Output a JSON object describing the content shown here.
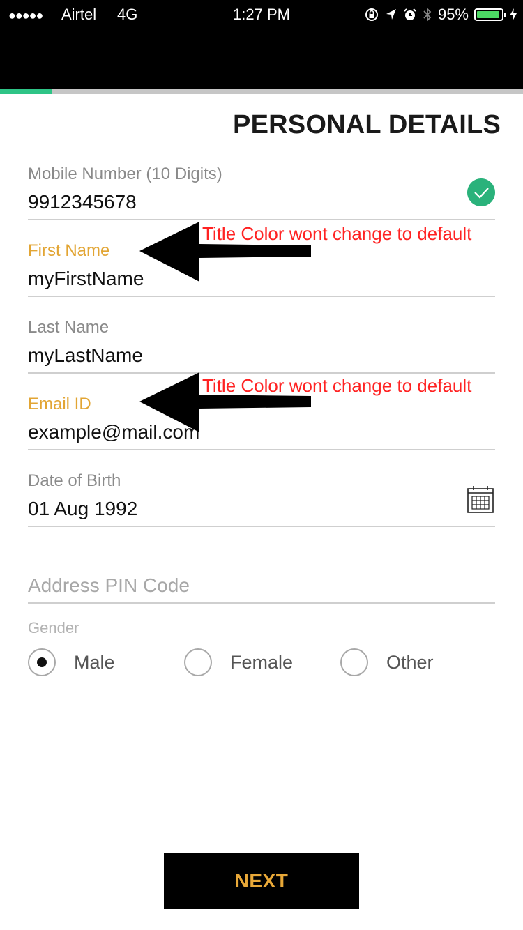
{
  "status_bar": {
    "signal": "●●●●●",
    "carrier": "Airtel",
    "network": "4G",
    "time": "1:27 PM",
    "battery_text": "95%",
    "battery_level": 0.95,
    "icons": [
      "lock-rotation-icon",
      "location-icon",
      "alarm-icon",
      "bluetooth-icon",
      "battery-icon",
      "charging-icon"
    ]
  },
  "progress": {
    "value": 0.1,
    "color": "#2ec486"
  },
  "page": {
    "title": "PERSONAL DETAILS"
  },
  "fields": {
    "mobile": {
      "label": "Mobile Number (10 Digits)",
      "value": "9912345678",
      "validated_icon": "check-circle-icon"
    },
    "first_name": {
      "label": "First Name",
      "value": "myFirstName"
    },
    "last_name": {
      "label": "Last Name",
      "value": "myLastName"
    },
    "email": {
      "label": "Email ID",
      "value": "example@mail.com"
    },
    "dob": {
      "label": "Date of Birth",
      "value": "01 Aug 1992",
      "icon": "calendar-icon"
    },
    "pin": {
      "placeholder": "Address PIN Code"
    }
  },
  "gender": {
    "label": "Gender",
    "options": [
      "Male",
      "Female",
      "Other"
    ],
    "selected": "Male"
  },
  "annotations": {
    "first_name_note": "Title Color wont change to default",
    "email_note": "Title Color wont change to default"
  },
  "colors": {
    "focused_label": "#e2a534",
    "annotation": "#ff2222",
    "accent_green": "#2ab27b",
    "next_text": "#e8a838"
  },
  "footer": {
    "next_label": "NEXT"
  }
}
